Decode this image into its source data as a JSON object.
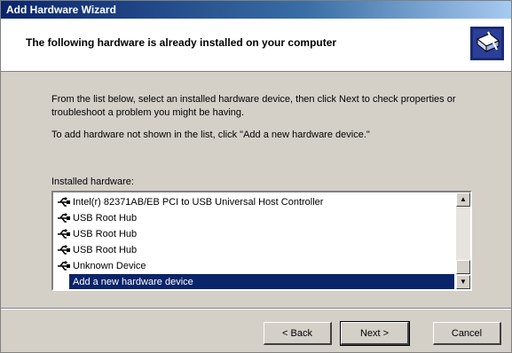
{
  "window": {
    "title": "Add Hardware Wizard"
  },
  "header": {
    "title": "The following hardware is already installed on your computer",
    "icon": "hardware-wizard-icon"
  },
  "content": {
    "instruction": "From the list below, select an installed hardware device, then click Next to check properties or troubleshoot a problem you might be having.",
    "add_hint": "To add hardware not shown in the list, click \"Add a new hardware device.\"",
    "list_label": "Installed hardware:",
    "items": [
      {
        "label": "Intel(r) 82371AB/EB PCI to USB Universal Host Controller",
        "icon": "usb-icon"
      },
      {
        "label": "USB Root Hub",
        "icon": "usb-icon"
      },
      {
        "label": "USB Root Hub",
        "icon": "usb-icon"
      },
      {
        "label": "USB Root Hub",
        "icon": "usb-icon"
      },
      {
        "label": "Unknown Device",
        "icon": "usb-icon"
      }
    ],
    "selected_item": "Add a new hardware device"
  },
  "buttons": {
    "back": "< Back",
    "next": "Next >",
    "cancel": "Cancel"
  },
  "colors": {
    "title_bar": "#0a246a",
    "selection": "#0a246a",
    "face": "#d4d0c8"
  }
}
